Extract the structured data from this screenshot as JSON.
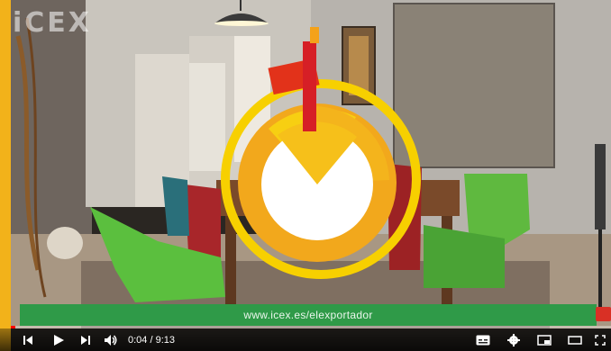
{
  "video": {
    "watermark": "iCEX",
    "overlay_url": "www.icex.es/elexportador",
    "current_time": "0:04",
    "duration": "9:13",
    "time_display": "0:04 / 9:13",
    "progress": 0.007,
    "accent_color": "#ff0000",
    "banner_color": "#2f9a48"
  },
  "controls": {
    "left": [
      "previous-icon",
      "play-icon",
      "next-icon",
      "volume-icon"
    ],
    "right": [
      "subtitles-icon",
      "settings-icon",
      "miniplayer-icon",
      "theater-mode-icon",
      "fullscreen-icon"
    ]
  }
}
